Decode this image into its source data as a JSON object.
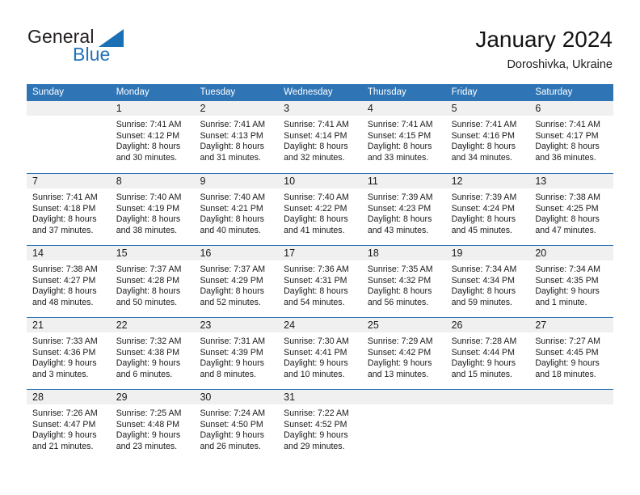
{
  "brand": {
    "name_dark": "General",
    "name_blue": "Blue",
    "triangle_icon": "triangle-icon",
    "accent_color": "#2272b8"
  },
  "header": {
    "title": "January 2024",
    "subtitle": "Doroshivka, Ukraine"
  },
  "theme": {
    "header_blue": "#2f74b5",
    "day_band_grey": "#f0f0f0",
    "text": "#1a1a1a"
  },
  "weekdays": [
    "Sunday",
    "Monday",
    "Tuesday",
    "Wednesday",
    "Thursday",
    "Friday",
    "Saturday"
  ],
  "weeks": [
    [
      {
        "day": "",
        "sunrise": "",
        "sunset": "",
        "daylight1": "",
        "daylight2": ""
      },
      {
        "day": "1",
        "sunrise": "Sunrise: 7:41 AM",
        "sunset": "Sunset: 4:12 PM",
        "daylight1": "Daylight: 8 hours",
        "daylight2": "and 30 minutes."
      },
      {
        "day": "2",
        "sunrise": "Sunrise: 7:41 AM",
        "sunset": "Sunset: 4:13 PM",
        "daylight1": "Daylight: 8 hours",
        "daylight2": "and 31 minutes."
      },
      {
        "day": "3",
        "sunrise": "Sunrise: 7:41 AM",
        "sunset": "Sunset: 4:14 PM",
        "daylight1": "Daylight: 8 hours",
        "daylight2": "and 32 minutes."
      },
      {
        "day": "4",
        "sunrise": "Sunrise: 7:41 AM",
        "sunset": "Sunset: 4:15 PM",
        "daylight1": "Daylight: 8 hours",
        "daylight2": "and 33 minutes."
      },
      {
        "day": "5",
        "sunrise": "Sunrise: 7:41 AM",
        "sunset": "Sunset: 4:16 PM",
        "daylight1": "Daylight: 8 hours",
        "daylight2": "and 34 minutes."
      },
      {
        "day": "6",
        "sunrise": "Sunrise: 7:41 AM",
        "sunset": "Sunset: 4:17 PM",
        "daylight1": "Daylight: 8 hours",
        "daylight2": "and 36 minutes."
      }
    ],
    [
      {
        "day": "7",
        "sunrise": "Sunrise: 7:41 AM",
        "sunset": "Sunset: 4:18 PM",
        "daylight1": "Daylight: 8 hours",
        "daylight2": "and 37 minutes."
      },
      {
        "day": "8",
        "sunrise": "Sunrise: 7:40 AM",
        "sunset": "Sunset: 4:19 PM",
        "daylight1": "Daylight: 8 hours",
        "daylight2": "and 38 minutes."
      },
      {
        "day": "9",
        "sunrise": "Sunrise: 7:40 AM",
        "sunset": "Sunset: 4:21 PM",
        "daylight1": "Daylight: 8 hours",
        "daylight2": "and 40 minutes."
      },
      {
        "day": "10",
        "sunrise": "Sunrise: 7:40 AM",
        "sunset": "Sunset: 4:22 PM",
        "daylight1": "Daylight: 8 hours",
        "daylight2": "and 41 minutes."
      },
      {
        "day": "11",
        "sunrise": "Sunrise: 7:39 AM",
        "sunset": "Sunset: 4:23 PM",
        "daylight1": "Daylight: 8 hours",
        "daylight2": "and 43 minutes."
      },
      {
        "day": "12",
        "sunrise": "Sunrise: 7:39 AM",
        "sunset": "Sunset: 4:24 PM",
        "daylight1": "Daylight: 8 hours",
        "daylight2": "and 45 minutes."
      },
      {
        "day": "13",
        "sunrise": "Sunrise: 7:38 AM",
        "sunset": "Sunset: 4:25 PM",
        "daylight1": "Daylight: 8 hours",
        "daylight2": "and 47 minutes."
      }
    ],
    [
      {
        "day": "14",
        "sunrise": "Sunrise: 7:38 AM",
        "sunset": "Sunset: 4:27 PM",
        "daylight1": "Daylight: 8 hours",
        "daylight2": "and 48 minutes."
      },
      {
        "day": "15",
        "sunrise": "Sunrise: 7:37 AM",
        "sunset": "Sunset: 4:28 PM",
        "daylight1": "Daylight: 8 hours",
        "daylight2": "and 50 minutes."
      },
      {
        "day": "16",
        "sunrise": "Sunrise: 7:37 AM",
        "sunset": "Sunset: 4:29 PM",
        "daylight1": "Daylight: 8 hours",
        "daylight2": "and 52 minutes."
      },
      {
        "day": "17",
        "sunrise": "Sunrise: 7:36 AM",
        "sunset": "Sunset: 4:31 PM",
        "daylight1": "Daylight: 8 hours",
        "daylight2": "and 54 minutes."
      },
      {
        "day": "18",
        "sunrise": "Sunrise: 7:35 AM",
        "sunset": "Sunset: 4:32 PM",
        "daylight1": "Daylight: 8 hours",
        "daylight2": "and 56 minutes."
      },
      {
        "day": "19",
        "sunrise": "Sunrise: 7:34 AM",
        "sunset": "Sunset: 4:34 PM",
        "daylight1": "Daylight: 8 hours",
        "daylight2": "and 59 minutes."
      },
      {
        "day": "20",
        "sunrise": "Sunrise: 7:34 AM",
        "sunset": "Sunset: 4:35 PM",
        "daylight1": "Daylight: 9 hours",
        "daylight2": "and 1 minute."
      }
    ],
    [
      {
        "day": "21",
        "sunrise": "Sunrise: 7:33 AM",
        "sunset": "Sunset: 4:36 PM",
        "daylight1": "Daylight: 9 hours",
        "daylight2": "and 3 minutes."
      },
      {
        "day": "22",
        "sunrise": "Sunrise: 7:32 AM",
        "sunset": "Sunset: 4:38 PM",
        "daylight1": "Daylight: 9 hours",
        "daylight2": "and 6 minutes."
      },
      {
        "day": "23",
        "sunrise": "Sunrise: 7:31 AM",
        "sunset": "Sunset: 4:39 PM",
        "daylight1": "Daylight: 9 hours",
        "daylight2": "and 8 minutes."
      },
      {
        "day": "24",
        "sunrise": "Sunrise: 7:30 AM",
        "sunset": "Sunset: 4:41 PM",
        "daylight1": "Daylight: 9 hours",
        "daylight2": "and 10 minutes."
      },
      {
        "day": "25",
        "sunrise": "Sunrise: 7:29 AM",
        "sunset": "Sunset: 4:42 PM",
        "daylight1": "Daylight: 9 hours",
        "daylight2": "and 13 minutes."
      },
      {
        "day": "26",
        "sunrise": "Sunrise: 7:28 AM",
        "sunset": "Sunset: 4:44 PM",
        "daylight1": "Daylight: 9 hours",
        "daylight2": "and 15 minutes."
      },
      {
        "day": "27",
        "sunrise": "Sunrise: 7:27 AM",
        "sunset": "Sunset: 4:45 PM",
        "daylight1": "Daylight: 9 hours",
        "daylight2": "and 18 minutes."
      }
    ],
    [
      {
        "day": "28",
        "sunrise": "Sunrise: 7:26 AM",
        "sunset": "Sunset: 4:47 PM",
        "daylight1": "Daylight: 9 hours",
        "daylight2": "and 21 minutes."
      },
      {
        "day": "29",
        "sunrise": "Sunrise: 7:25 AM",
        "sunset": "Sunset: 4:48 PM",
        "daylight1": "Daylight: 9 hours",
        "daylight2": "and 23 minutes."
      },
      {
        "day": "30",
        "sunrise": "Sunrise: 7:24 AM",
        "sunset": "Sunset: 4:50 PM",
        "daylight1": "Daylight: 9 hours",
        "daylight2": "and 26 minutes."
      },
      {
        "day": "31",
        "sunrise": "Sunrise: 7:22 AM",
        "sunset": "Sunset: 4:52 PM",
        "daylight1": "Daylight: 9 hours",
        "daylight2": "and 29 minutes."
      },
      {
        "day": "",
        "sunrise": "",
        "sunset": "",
        "daylight1": "",
        "daylight2": ""
      },
      {
        "day": "",
        "sunrise": "",
        "sunset": "",
        "daylight1": "",
        "daylight2": ""
      },
      {
        "day": "",
        "sunrise": "",
        "sunset": "",
        "daylight1": "",
        "daylight2": ""
      }
    ]
  ]
}
